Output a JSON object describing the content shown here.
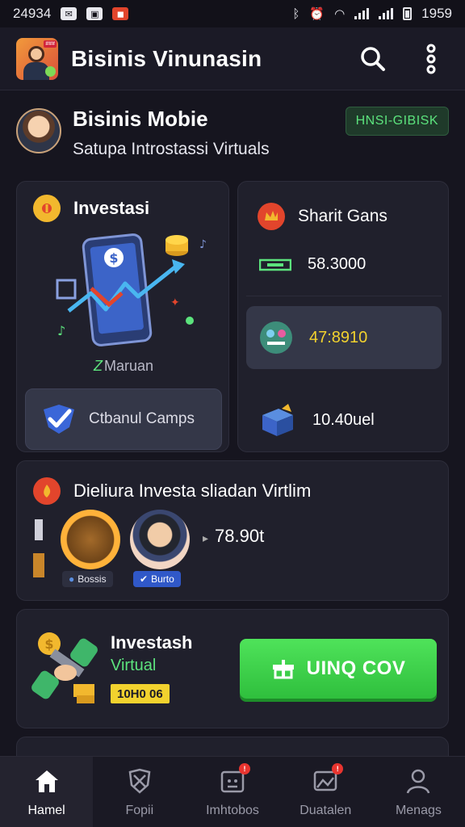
{
  "status_bar": {
    "left_number": "24934",
    "time": "1959",
    "notification_icons": [
      "message-icon",
      "photo-icon",
      "shop-icon"
    ],
    "system_icons": [
      "bluetooth-icon",
      "alarm-icon",
      "wifi-icon",
      "signal-icon",
      "battery-icon"
    ]
  },
  "app_bar": {
    "title": "Bisinis Vinunasin",
    "actions": [
      "search-icon",
      "more-icon"
    ]
  },
  "profile": {
    "name": "Bisinis Mobie",
    "subtitle": "Satupa Introstassi Virtuals",
    "badge": "HNSI-GIBISK"
  },
  "invest_card": {
    "title": "Investasi",
    "caption_prefix": "Z",
    "caption": "Maruan",
    "button_label": "Ctbanul Camps"
  },
  "shares_card": {
    "title": "Sharit Gans",
    "rows": [
      {
        "icon": "cash-icon",
        "value": "58.3000",
        "accent": "#5ce37d"
      },
      {
        "icon": "chip-icon",
        "value": "47:8910",
        "accent": "#f2d22e"
      },
      {
        "icon": "box-icon",
        "value": "10.40uel",
        "accent": "#5ce37d"
      }
    ]
  },
  "virtual_card": {
    "title": "Dieliura Investa sliadan Virtlim",
    "holders": [
      {
        "chip": "Bossis"
      },
      {
        "chip": "Burto"
      }
    ],
    "amount": "78.90t"
  },
  "promo_card": {
    "title": "Investash",
    "subtitle": "Virtual",
    "tag": "10H0 06",
    "button_label": "UINQ COV"
  },
  "bottom_nav": [
    {
      "label": "Hamel",
      "icon": "home-icon",
      "active": true,
      "badge": false
    },
    {
      "label": "Fopii",
      "icon": "shield-icon",
      "active": false,
      "badge": false
    },
    {
      "label": "Imhtobos",
      "icon": "calendar-icon",
      "active": false,
      "badge": true
    },
    {
      "label": "Duatalen",
      "icon": "gallery-icon",
      "active": false,
      "badge": true
    },
    {
      "label": "Menags",
      "icon": "person-icon",
      "active": false,
      "badge": false
    }
  ],
  "colors": {
    "background": "#16151f",
    "card": "#20202c",
    "accent_green": "#5ce37d",
    "accent_yellow": "#f2d22e",
    "button_green": "#3fd24b"
  }
}
